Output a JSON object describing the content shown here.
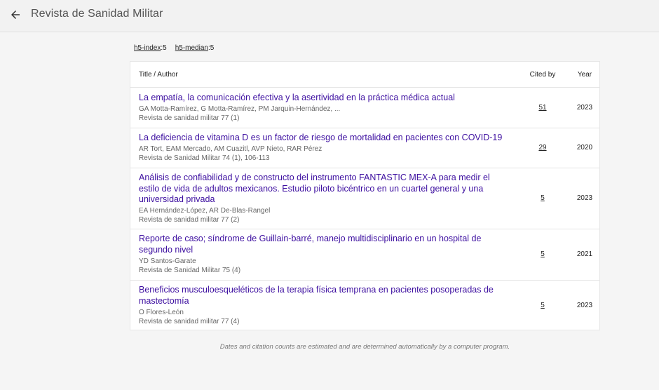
{
  "header": {
    "title": "Revista de Sanidad Militar"
  },
  "metrics": {
    "h5_index_label": "h5-index",
    "h5_index_value": ":5",
    "h5_median_label": "h5-median",
    "h5_median_value": ":5"
  },
  "table": {
    "col_title": "Title / Author",
    "col_cited": "Cited by",
    "col_year": "Year",
    "rows": [
      {
        "title": "La empatía, la comunicación efectiva y la asertividad en la práctica médica actual",
        "authors": "GA Motta-Ramírez, G Motta-Ramírez, PM Jarquin-Hernández, ...",
        "source": "Revista de sanidad militar 77 (1)",
        "cited": "51",
        "year": "2023"
      },
      {
        "title": "La deficiencia de vitamina D es un factor de riesgo de mortalidad en pacientes con COVID-19",
        "authors": "AR Tort, EAM Mercado, AM Cuazitl, AVP Nieto, RAR Pérez",
        "source": "Revista de Sanidad Militar 74 (1), 106-113",
        "cited": "29",
        "year": "2020"
      },
      {
        "title": "Análisis de confiabilidad y de constructo del instrumento FANTASTIC MEX-A para medir el estilo de vida de adultos mexicanos. Estudio piloto bicéntrico en un cuartel general y una universidad privada",
        "authors": "EA Hernández-López, AR De-Blas-Rangel",
        "source": "Revista de sanidad militar 77 (2)",
        "cited": "5",
        "year": "2023"
      },
      {
        "title": "Reporte de caso; síndrome de Guillain-barré, manejo multidisciplinario en un hospital de segundo nivel",
        "authors": "YD Santos-Garate",
        "source": "Revista de Sanidad Militar 75 (4)",
        "cited": "5",
        "year": "2021"
      },
      {
        "title": "Beneficios musculoesqueléticos de la terapia física temprana en pacientes posoperadas de mastectomía",
        "authors": "O Flores-León",
        "source": "Revista de sanidad militar 77 (4)",
        "cited": "5",
        "year": "2023"
      }
    ]
  },
  "footnote": "Dates and citation counts are estimated and are determined automatically by a computer program."
}
